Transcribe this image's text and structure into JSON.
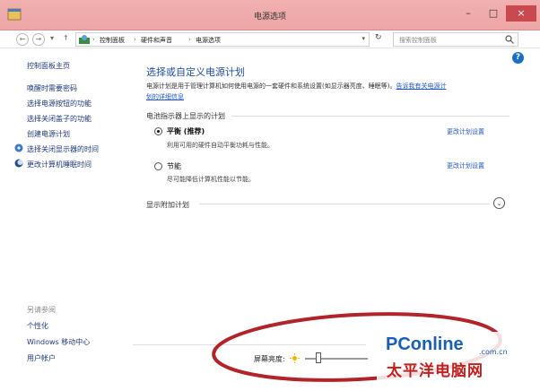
{
  "window": {
    "title": "电源选项",
    "min_label": "–",
    "max_label": "□",
    "close_label": "×"
  },
  "nav": {
    "breadcrumbs": [
      "控制面板",
      "硬件和声音",
      "电源选项"
    ],
    "separator": "›",
    "search_placeholder": "搜索控制面板"
  },
  "sidebar": {
    "home": "控制面板主页",
    "links": [
      "唤醒时需要密码",
      "选择电源按钮的功能",
      "选择关闭盖子的功能",
      "创建电源计划",
      "选择关闭显示器的时间",
      "更改计算机睡眠时间"
    ],
    "see_also_header": "另请参阅",
    "see_also": [
      "个性化",
      "Windows 移动中心",
      "用户帐户"
    ]
  },
  "main": {
    "title": "选择或自定义电源计划",
    "description_line1": "电源计划是用于管理计算机如何使用电源的一套硬件和系统设置(如显示器亮度、睡眠等)。",
    "description_link_a": "告诉我有关电源计",
    "description_link_b": "划的详细信息",
    "section_label": "电池指示器上显示的计划",
    "plans": [
      {
        "name": "平衡 (推荐)",
        "desc": "利用可用的硬件自动平衡功耗与性能。",
        "selected": true,
        "link": "更改计划设置"
      },
      {
        "name": "节能",
        "desc": "尽可能降低计算机性能以节能。",
        "selected": false,
        "link": "更改计划设置"
      }
    ],
    "additional_plans": "显示附加计划"
  },
  "bottom": {
    "brightness_label": "屏幕亮度:",
    "brightness_level": 0.21
  },
  "watermark": {
    "brand": "PConline",
    "domain": ".com.cn",
    "chinese": "太平洋电脑网"
  },
  "colors": {
    "titlebar": "#efaaab",
    "close_button": "#c84a4f",
    "link": "#1f57c8",
    "annotation": "#b0242a"
  }
}
